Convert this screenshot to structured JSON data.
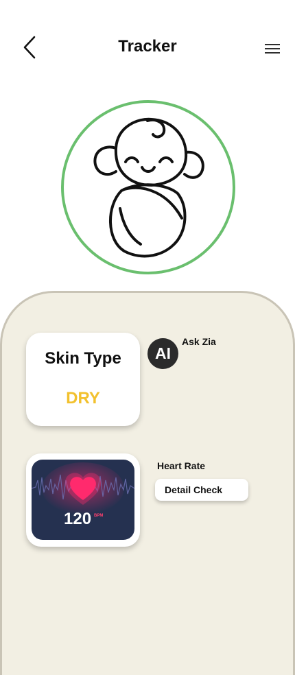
{
  "header": {
    "title": "Tracker",
    "back_icon": "chevron-left-icon",
    "menu_icon": "hamburger-menu-icon"
  },
  "avatar": {
    "icon": "swaddled-baby-icon",
    "ring_color": "#6abf6e"
  },
  "skin_card": {
    "title": "Skin Type",
    "value": "DRY",
    "value_color": "#f2c12e"
  },
  "assistant": {
    "badge": "AI",
    "label": "Ask Zia"
  },
  "heart_card": {
    "value": "120",
    "unit": "BPM",
    "icon": "heart-icon",
    "accent_color": "#ff2a6d"
  },
  "heart_rate": {
    "label": "Heart Rate",
    "button_label": "Detail Check"
  },
  "colors": {
    "panel_background": "#f2efe3",
    "heart_card_background": "#253150"
  }
}
